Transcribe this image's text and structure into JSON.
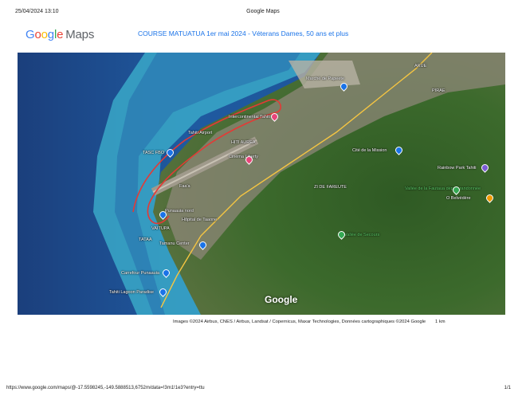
{
  "print_header": {
    "datetime": "25/04/2024 13:10",
    "page_title": "Google Maps"
  },
  "logo": {
    "google": "Google",
    "maps": "Maps"
  },
  "route_title": "COURSE MATUATUA 1er mai 2024 - Véterans Dames, 50 ans et plus",
  "map": {
    "watermark": "Google",
    "route_color": "#e53935",
    "labels": {
      "marche": "Marché de Papeete",
      "intercontinental": "Intercontinental Tahiti",
      "tahiti_airport": "Tahiti Airport",
      "tasc": "TASC FBO",
      "hiti": "HITI AUREA",
      "cine": "Cinéma Liberty",
      "pirae": "PIRAE",
      "arue": "ARUE",
      "mission": "Cité de la Mission",
      "faaa": "Faa'a",
      "delfaro": "ZI DE FAREUTE",
      "ecole": "Vallée de la Fautaua départ randonnée",
      "rainbow": "Rainbow Park Tahiti",
      "belvedere": "O Belvédère",
      "vallee_secours": "Vallée de Secours",
      "hopital": "Hôpital de Taaone",
      "punaauia_north": "Punaauia nord",
      "vaitupa": "VAITUPA",
      "tataa": "TATAA",
      "carrefour": "Carrefour Punaauia",
      "lagoon": "Tahiti Lagoon Paradise",
      "tamanu": "Tamanu Center"
    }
  },
  "attribution": "Images ©2024 Airbus, CNES / Airbus, Landsat / Copernicus, Maxar Technologies, Données cartographiques ©2024 Google",
  "scale": "1 km",
  "footer": {
    "url": "https://www.google.com/maps/@-17.5598245,-149.5888513,6752m/data=!3m1!1e3?entry=ttu",
    "page": "1/1"
  }
}
